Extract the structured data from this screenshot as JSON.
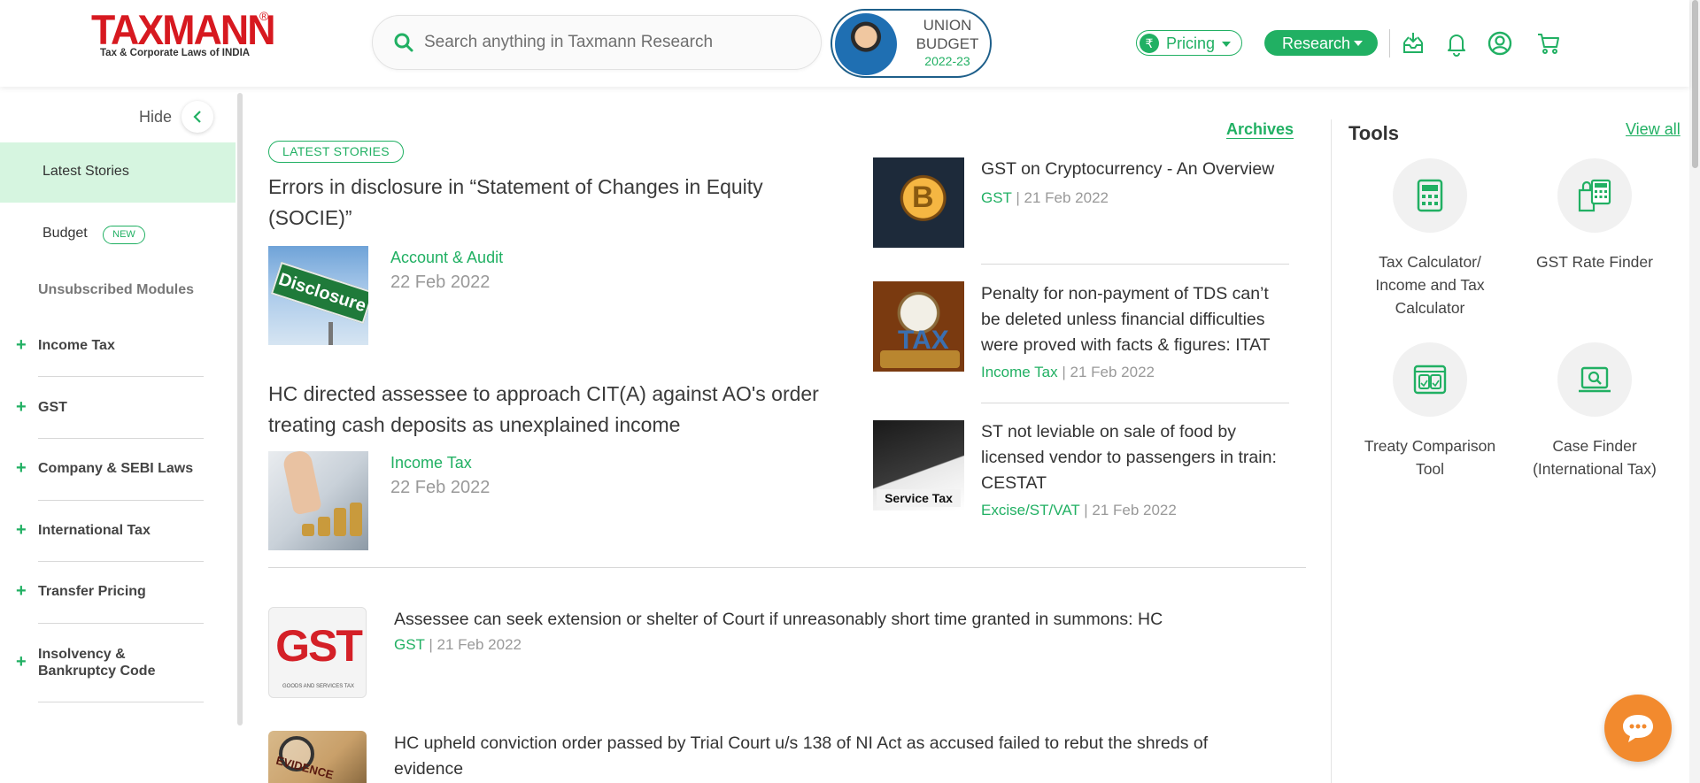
{
  "brand": {
    "logo_word": "TAXMANN",
    "logo_reg": "®",
    "logo_tagline": "Tax & Corporate Laws of INDIA",
    "accent": "#21b063",
    "logo_color": "#d71920"
  },
  "header": {
    "search_placeholder": "Search anything in Taxmann Research",
    "budget_line1": "UNION",
    "budget_line2": "BUDGET",
    "budget_year": "2022-23",
    "pricing_label": "Pricing",
    "rupee_symbol": "₹",
    "research_label": "Research",
    "icons": [
      "inbox-download-icon",
      "bell-icon",
      "user-circle-icon",
      "cart-icon"
    ]
  },
  "sidebar": {
    "hide_label": "Hide",
    "active_item": "Latest Stories",
    "budget_label": "Budget",
    "budget_badge": "NEW",
    "unsubscribed_label": "Unsubscribed Modules",
    "modules": [
      {
        "label": "Income Tax"
      },
      {
        "label": "GST"
      },
      {
        "label": "Company & SEBI Laws"
      },
      {
        "label": "International Tax"
      },
      {
        "label": "Transfer Pricing"
      },
      {
        "label": "Insolvency & Bankruptcy Code"
      }
    ]
  },
  "main": {
    "latest_badge": "LATEST STORIES",
    "archives_label": "Archives",
    "featured": [
      {
        "title": "Errors in disclosure in “Statement of Changes in Equity (SOCIE)”",
        "category": "Account & Audit",
        "date": "22 Feb 2022",
        "thumb_text": "Disclosure"
      },
      {
        "title": "HC directed assessee to approach CIT(A) against AO's order treating cash deposits as unexplained income",
        "category": "Income Tax",
        "date": "22 Feb 2022"
      }
    ],
    "right_stories": [
      {
        "title": "GST on Cryptocurrency - An Overview",
        "category": "GST",
        "date": "21 Feb 2022"
      },
      {
        "title": "Penalty for non-payment of TDS can’t be deleted unless financial difficulties were proved with facts & figures: ITAT",
        "category": "Income Tax",
        "date": "21 Feb 2022",
        "thumb_text": "TAX"
      },
      {
        "title": "ST not leviable on sale of food by licensed vendor to passengers in train: CESTAT",
        "category": "Excise/ST/VAT",
        "date": "21 Feb 2022",
        "thumb_text": "Service Tax"
      }
    ],
    "list": [
      {
        "title": "Assessee can seek extension or shelter of Court if unreasonably short time granted in summons: HC",
        "category": "GST",
        "date": "21 Feb 2022",
        "thumb_text": "GST",
        "thumb_sub": "GOODS AND SERVICES TAX"
      },
      {
        "title": "HC upheld conviction order passed by Trial Court u/s 138 of NI Act as accused failed to rebut the shreds of evidence",
        "thumb_text": "EVIDENCE"
      }
    ],
    "sep": "|"
  },
  "tools": {
    "heading": "Tools",
    "view_all": "View all",
    "items": [
      {
        "label": "Tax Calculator/ Income and Tax Calculator",
        "icon": "calculator-icon"
      },
      {
        "label": "GST Rate Finder",
        "icon": "shopping-bag-calculator-icon"
      },
      {
        "label": "Treaty Comparison Tool",
        "icon": "compare-window-icon"
      },
      {
        "label": "Case Finder (International Tax)",
        "icon": "laptop-search-icon"
      }
    ]
  }
}
